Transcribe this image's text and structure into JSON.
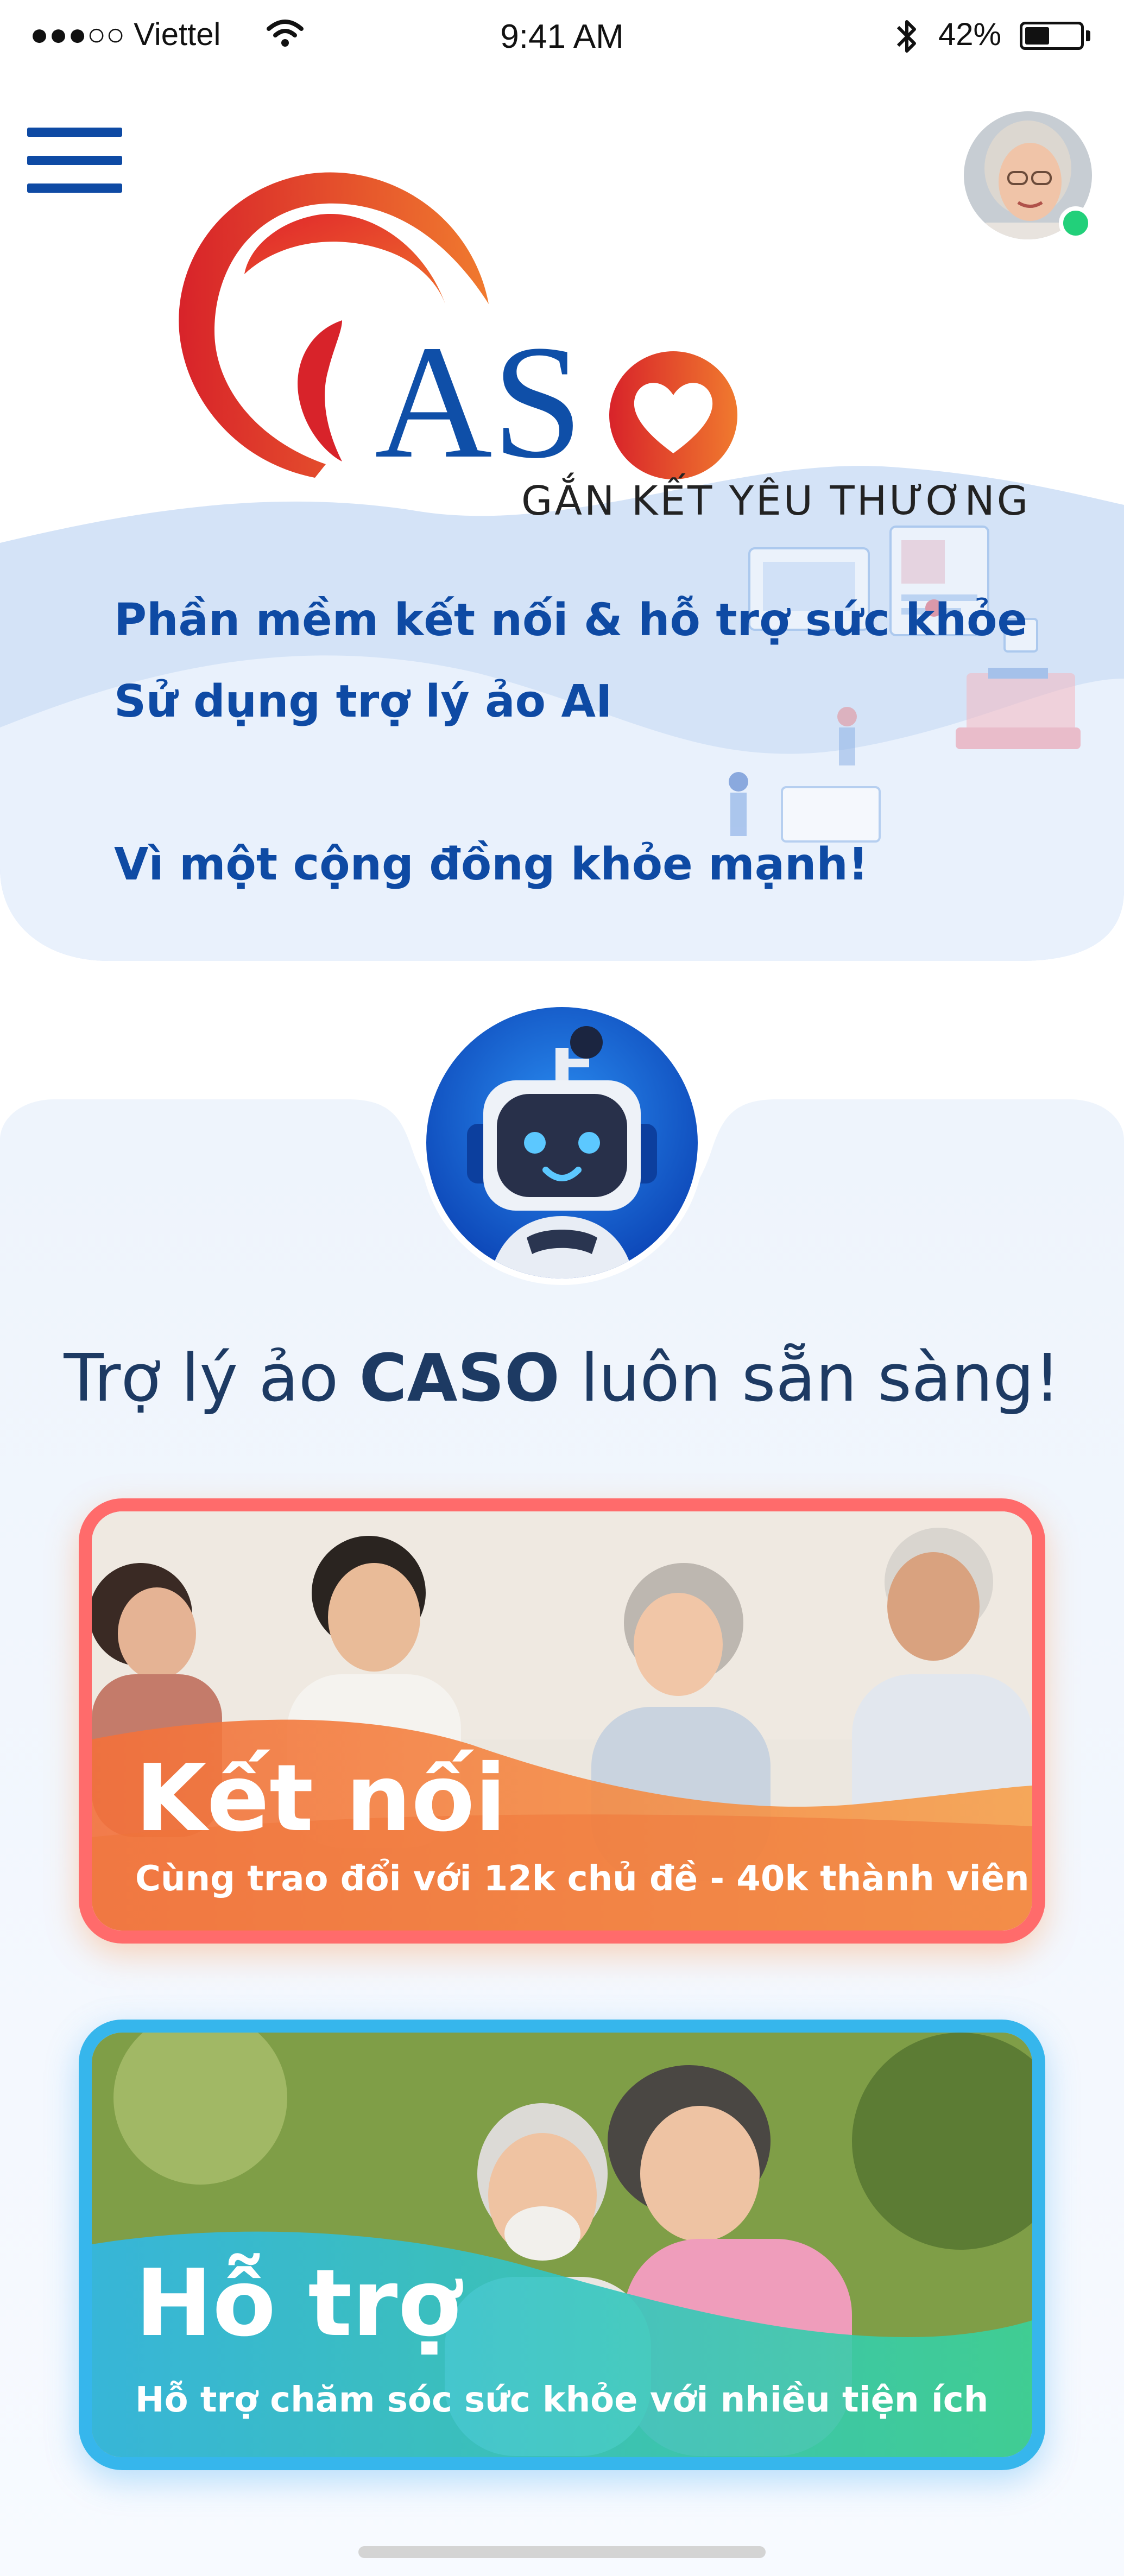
{
  "status_bar": {
    "carrier": "●●●○○ Viettel",
    "time": "9:41 AM",
    "battery": "42%",
    "battery_level": 0.42
  },
  "header": {
    "menu_icon": "hamburger-menu-icon",
    "avatar_online": true
  },
  "logo": {
    "brand_text": "AS",
    "tagline": "GẮN KẾT YÊU THƯƠNG"
  },
  "hero": {
    "line1": "Phần mềm kết nối & hỗ trợ sức khỏe",
    "line2": "Sử dụng trợ lý ảo AI",
    "line3": "Vì một cộng đồng khỏe mạnh!"
  },
  "assistant": {
    "title_prefix": "Trợ lý ảo ",
    "title_brand": "CASO",
    "title_suffix": " luôn sẵn sàng!"
  },
  "cards": [
    {
      "title": "Kết nối",
      "subtitle": "Cùng trao đổi với 12k chủ đề - 40k thành viên"
    },
    {
      "title": "Hỗ trợ",
      "subtitle": "Hỗ trợ chăm sóc sức khỏe với nhiều tiện ích"
    }
  ],
  "colors": {
    "brand_blue": "#0e4aa4",
    "brand_red": "#e0262b",
    "brand_orange": "#f07a2e",
    "card1_border": "#ff6b6b",
    "card2_border": "#36b6ec",
    "online_dot": "#22d07a"
  }
}
